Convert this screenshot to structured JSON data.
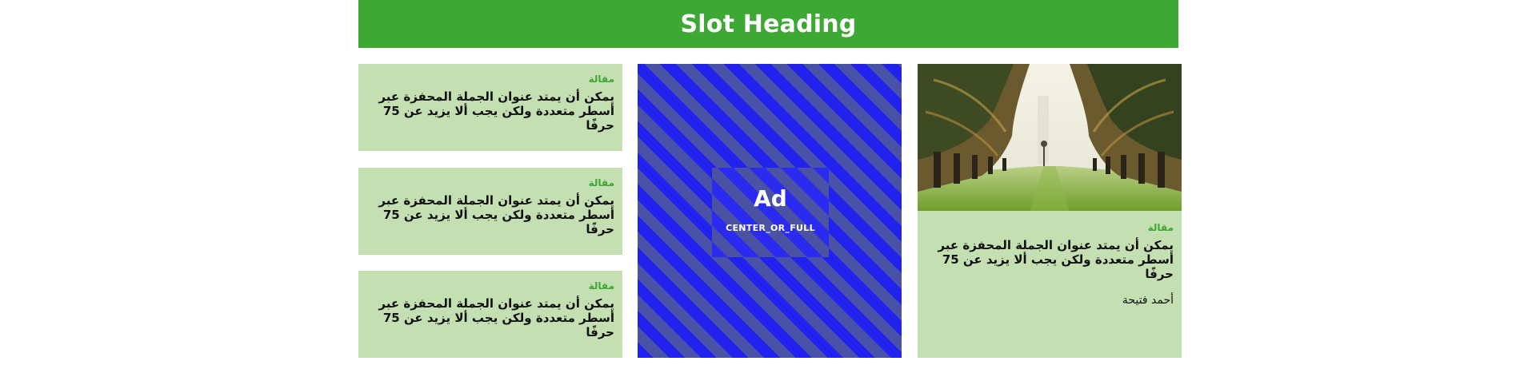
{
  "heading": {
    "title": "Slot Heading"
  },
  "articles": [
    {
      "label": "مقالة",
      "headline": "يمكن أن يمتد عنوان الجملة المحفزة عبر أسطر متعددة ولكن يجب ألا يزيد عن 75 حرفًا"
    },
    {
      "label": "مقالة",
      "headline": "يمكن أن يمتد عنوان الجملة المحفزة عبر أسطر متعددة ولكن يجب ألا يزيد عن 75 حرفًا"
    },
    {
      "label": "مقالة",
      "headline": "يمكن أن يمتد عنوان الجملة المحفزة عبر أسطر متعددة ولكن يجب ألا يزيد عن 75 حرفًا"
    }
  ],
  "ad": {
    "title": "Ad",
    "placement": "CENTER_OR_FULL"
  },
  "feature": {
    "label": "مقالة",
    "headline": "يمكن أن يمتد عنوان الجملة المحفزة عبر أسطر متعددة ولكن يجب ألا يزيد عن 75 حرفًا",
    "author": "أحمد فتيحة",
    "image_subject": "palm-tree-avenue"
  },
  "colors": {
    "heading_bg": "#3ea834",
    "card_bg": "#c4dfb2",
    "label": "#3ea834",
    "ad_stripe_a": "#2222ee",
    "ad_stripe_b": "#4a52a8"
  }
}
